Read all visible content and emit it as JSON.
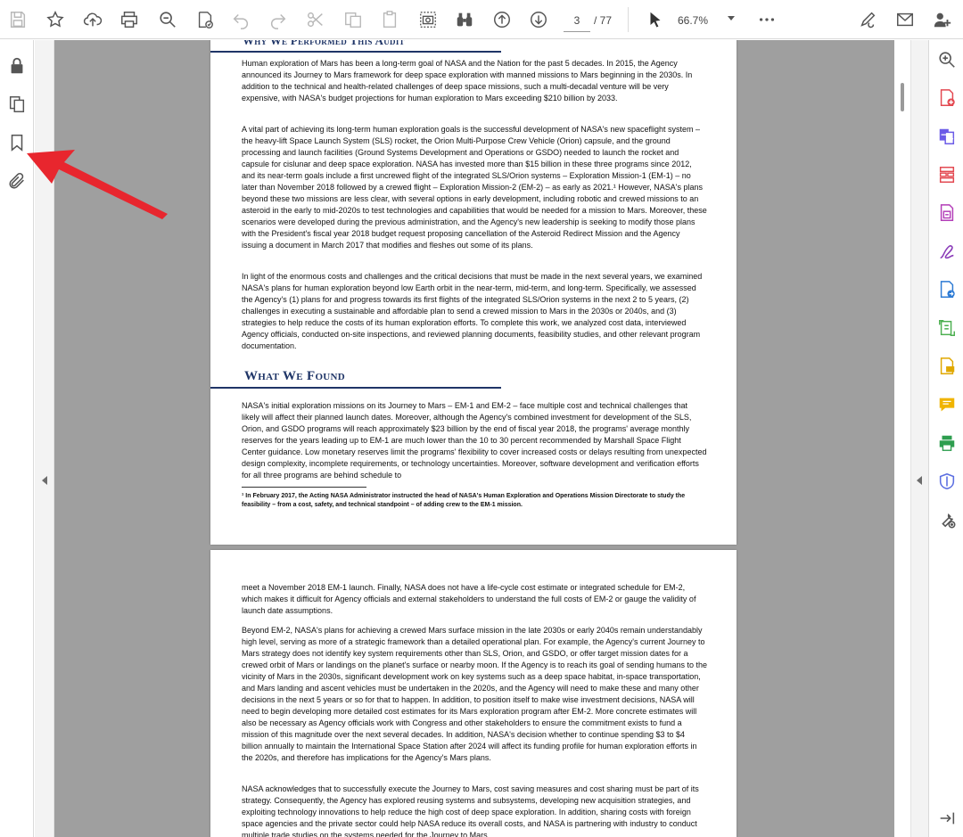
{
  "toolbar": {
    "page_current": "3",
    "page_total": "/ 77",
    "zoom": "66.7%",
    "icons": [
      "save-icon",
      "bookmark-star-icon",
      "upload-icon",
      "print-icon",
      "zoom-search-icon",
      "certify-icon",
      "undo-icon",
      "redo-icon",
      "cut-icon",
      "copy-icon",
      "paste-icon",
      "snapshot-icon",
      "binoculars-icon",
      "page-up-icon",
      "page-down-icon",
      "select-cursor-icon",
      "more-icon",
      "share-link-icon",
      "email-icon",
      "add-user-icon"
    ]
  },
  "left_rail": {
    "icons": [
      "lock-icon",
      "page-thumbnails-icon",
      "bookmark-icon",
      "attachment-icon"
    ]
  },
  "right_rail": {
    "icons": [
      "zoom-pages-icon",
      "create-pdf-icon",
      "export-pdf-icon",
      "organize-pages-icon",
      "edit-pdf-icon",
      "fill-sign-icon",
      "send-for-signature-icon",
      "scan-ocr-icon",
      "comment-file-icon",
      "comment-icon",
      "print-production-icon",
      "protect-icon",
      "tools-icon",
      "collapse-panel-icon"
    ]
  },
  "colors": {
    "heading_navy": "#1f3567",
    "annotation_arrow": "#e8262e",
    "doc_background": "#9f9f9f"
  },
  "document": {
    "page1": {
      "heading_top": "Why We Performed This Audit",
      "para1": "Human exploration of Mars has been a long-term goal of NASA and the Nation for the past 5 decades. In 2015, the Agency announced its Journey to Mars framework for deep space exploration with manned missions to Mars beginning in the 2030s. In addition to the technical and health-related challenges of deep space missions, such a multi-decadal venture will be very expensive, with NASA's budget projections for human exploration to Mars exceeding $210 billion by 2033.",
      "para2": "A vital part of achieving its long-term human exploration goals is the successful development of NASA's new spaceflight system – the heavy-lift Space Launch System (SLS) rocket, the Orion Multi-Purpose Crew Vehicle (Orion) capsule, and the ground processing and launch facilities (Ground Systems Development and Operations or GSDO) needed to launch the rocket and capsule for cislunar and deep space exploration. NASA has invested more than $15 billion in these three programs since 2012, and its near-term goals include a first uncrewed flight of the integrated SLS/Orion systems – Exploration Mission-1 (EM-1) – no later than November 2018 followed by a crewed flight – Exploration Mission-2 (EM-2) – as early as 2021.¹ However, NASA's plans beyond these two missions are less clear, with several options in early development, including robotic and crewed missions to an asteroid in the early to mid-2020s to test technologies and capabilities that would be needed for a mission to Mars. Moreover, these scenarios were developed during the previous administration, and the Agency's new leadership is seeking to modify those plans with the President's fiscal year 2018 budget request proposing cancellation of the Asteroid Redirect Mission and the Agency issuing a document in March 2017 that modifies and fleshes out some of its plans.",
      "para3": "In light of the enormous costs and challenges and the critical decisions that must be made in the next several years, we examined NASA's plans for human exploration beyond low Earth orbit in the near-term, mid-term, and long-term. Specifically, we assessed the Agency's (1) plans for and progress towards its first flights of the integrated SLS/Orion systems in the next 2 to 5 years, (2) challenges in executing a sustainable and affordable plan to send a crewed mission to Mars in the 2030s or 2040s, and (3) strategies to help reduce the costs of its human exploration efforts. To complete this work, we analyzed cost data, interviewed Agency officials, conducted on-site inspections, and reviewed planning documents, feasibility studies, and other relevant program documentation.",
      "heading_found": "What We Found",
      "para4": "NASA's initial exploration missions on its Journey to Mars – EM-1 and EM-2 – face multiple cost and technical challenges that likely will affect their planned launch dates. Moreover, although the Agency's combined investment for development of the SLS, Orion, and GSDO programs will reach approximately $23 billion by the end of fiscal year 2018, the programs' average monthly reserves for the years leading up to EM-1 are much lower than the 10 to 30 percent recommended by Marshall Space Flight Center guidance. Low monetary reserves limit the programs' flexibility to cover increased costs or delays resulting from unexpected design complexity, incomplete requirements, or technology uncertainties. Moreover, software development and verification efforts for all three programs are behind schedule to",
      "footnote": "¹ In February 2017, the Acting NASA Administrator instructed the head of NASA's Human Exploration and Operations Mission Directorate to study the feasibility – from a cost, safety, and technical standpoint – of adding crew to the EM-1 mission."
    },
    "page2": {
      "para1": "meet a November 2018 EM-1 launch. Finally, NASA does not have a life-cycle cost estimate or integrated schedule for EM-2, which makes it difficult for Agency officials and external stakeholders to understand the full costs of EM-2 or gauge the validity of launch date assumptions.",
      "para2": "Beyond EM-2, NASA's plans for achieving a crewed Mars surface mission in the late 2030s or early 2040s remain understandably high level, serving as more of a strategic framework than a detailed operational plan. For example, the Agency's current Journey to Mars strategy does not identify key system requirements other than SLS, Orion, and GSDO, or offer target mission dates for a crewed orbit of Mars or landings on the planet's surface or nearby moon. If the Agency is to reach its goal of sending humans to the vicinity of Mars in the 2030s, significant development work on key systems such as a deep space habitat, in-space transportation, and Mars landing and ascent vehicles must be undertaken in the 2020s, and the Agency will need to make these and many other decisions in the next 5 years or so for that to happen. In addition, to position itself to make wise investment decisions, NASA will need to begin developing more detailed cost estimates for its Mars exploration program after EM-2. More concrete estimates will also be necessary as Agency officials work with Congress and other stakeholders to ensure the commitment exists to fund a mission of this magnitude over the next several decades. In addition, NASA's decision whether to continue spending $3 to $4 billion annually to maintain the International Space Station after 2024 will affect its funding profile for human exploration efforts in the 2020s, and therefore has implications for the Agency's Mars plans.",
      "para3": "NASA acknowledges that to successfully execute the Journey to Mars, cost saving measures and cost sharing must be part of its strategy. Consequently, the Agency has explored reusing systems and subsystems, developing new acquisition strategies, and exploiting technology innovations to help reduce the high cost of deep space exploration. In addition, sharing costs with foreign space agencies and the private sector could help NASA reduce its overall costs, and NASA is partnering with industry to conduct multiple trade studies on the systems needed for the Journey to Mars"
    }
  }
}
